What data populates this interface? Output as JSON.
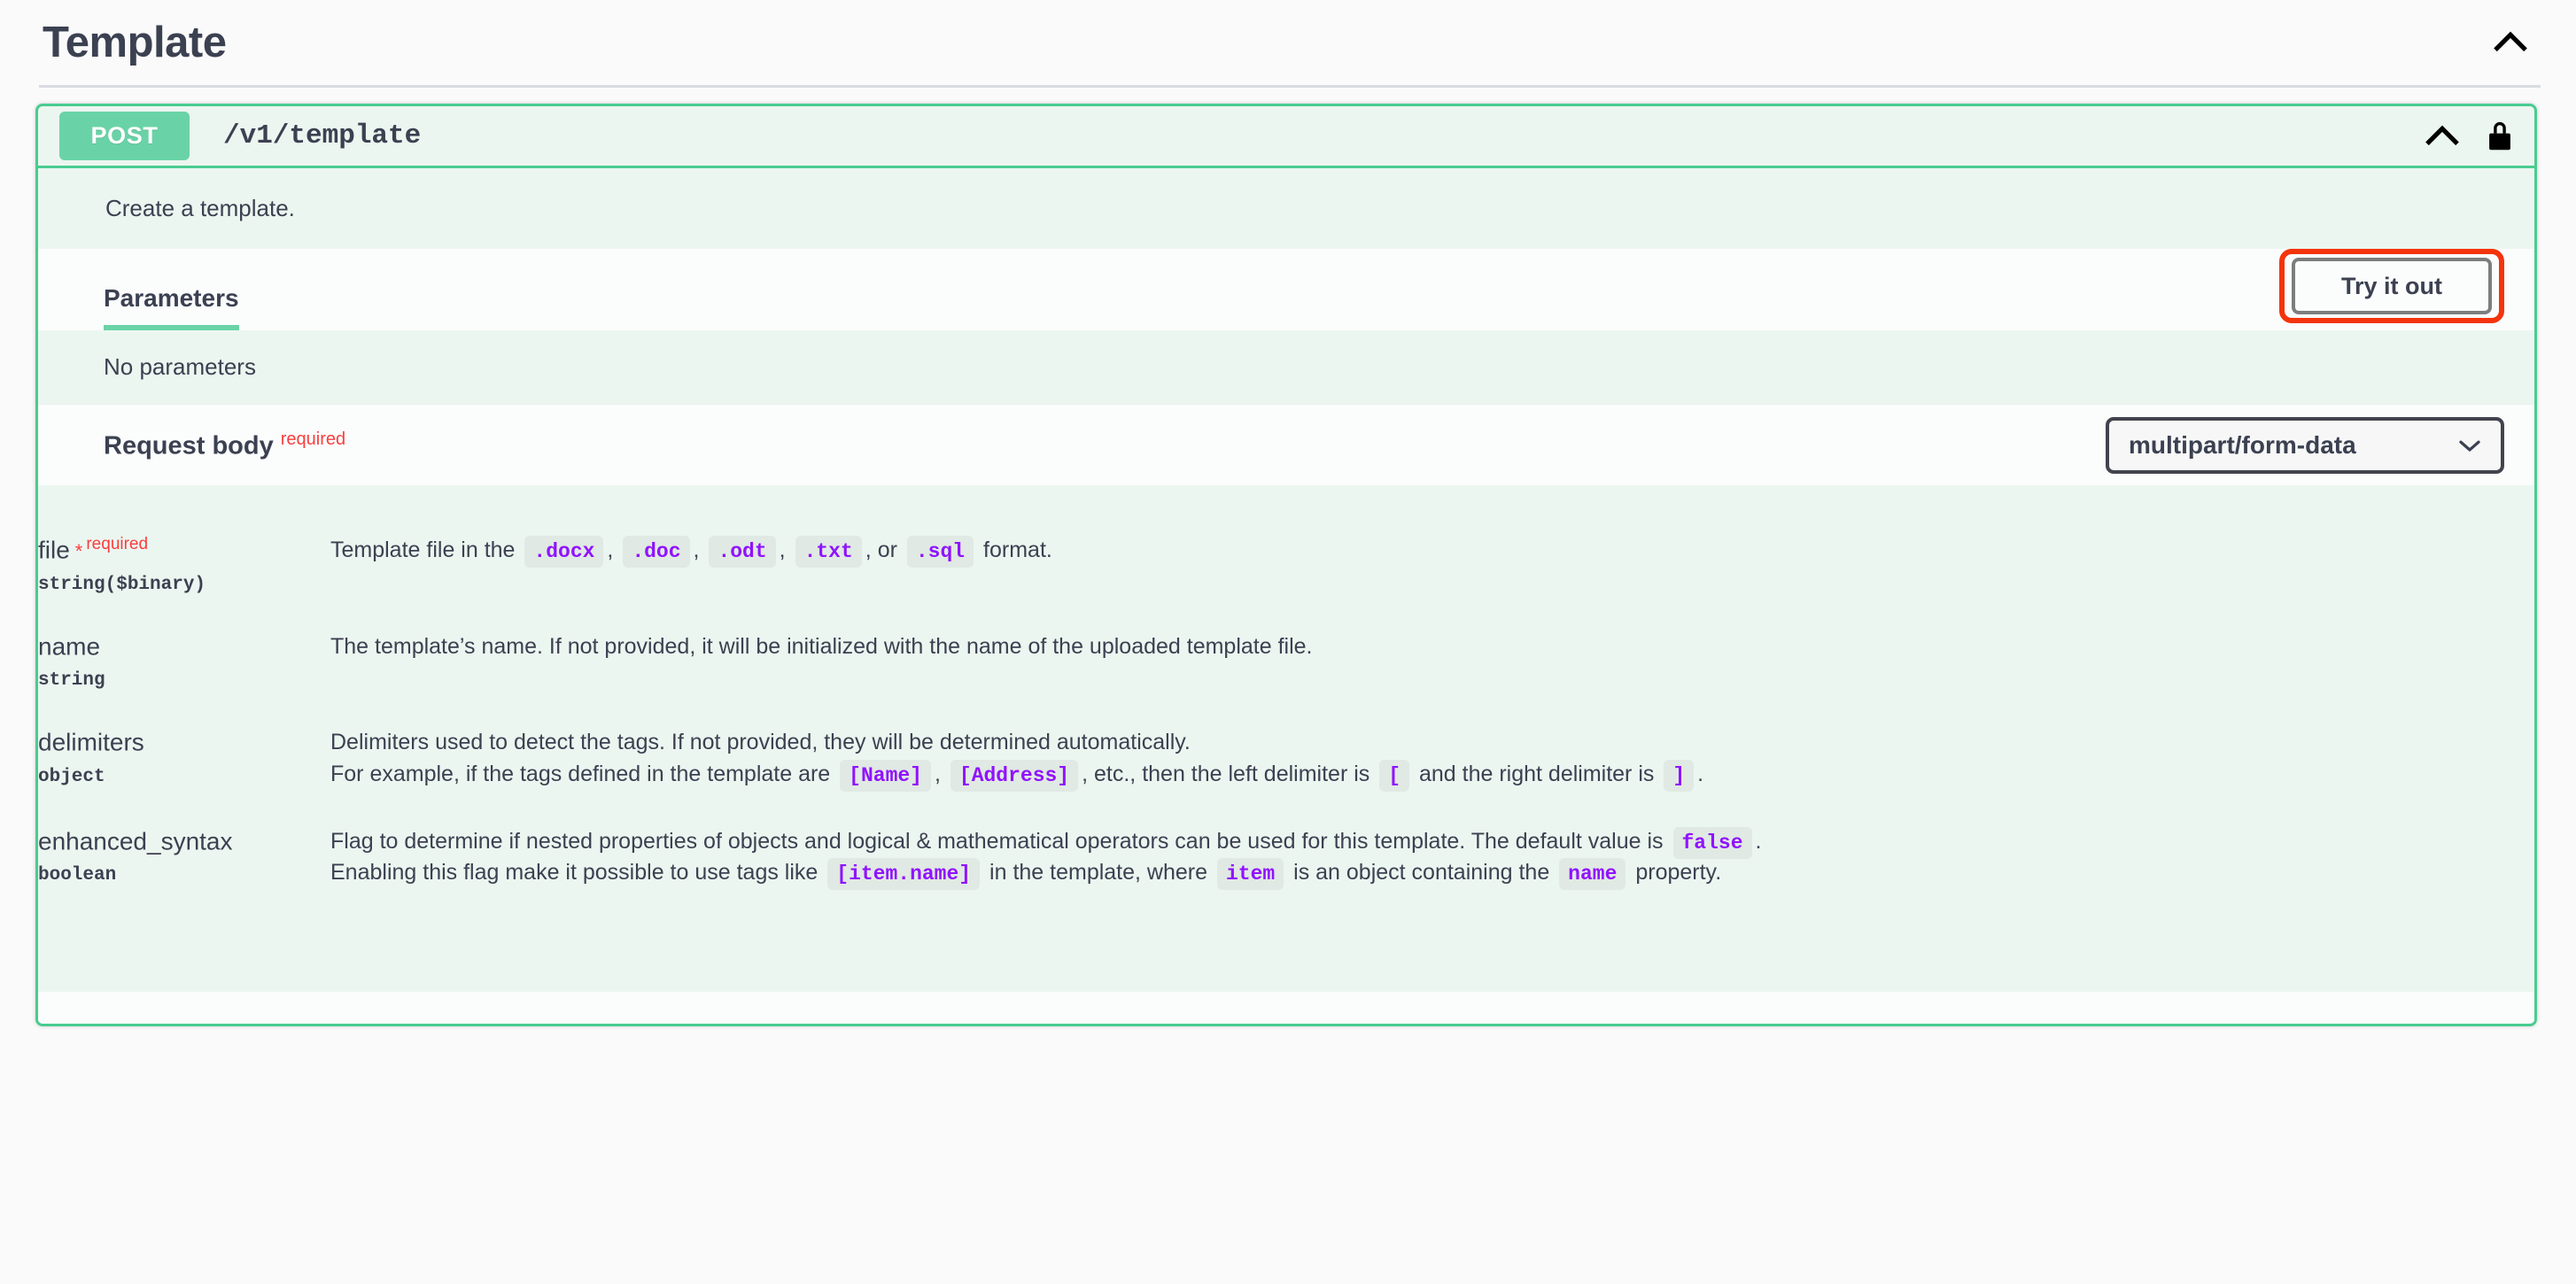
{
  "tag": {
    "title": "Template",
    "collapse_icon": "chevron-up-icon"
  },
  "operation": {
    "method": "POST",
    "path": "/v1/template",
    "description": "Create a template.",
    "auth_icon": "lock-icon",
    "collapse_icon": "chevron-up-icon"
  },
  "parameters_section": {
    "tab_label": "Parameters",
    "try_it_out_label": "Try it out",
    "no_parameters_text": "No parameters"
  },
  "request_body": {
    "label": "Request body",
    "required_flag": "required",
    "content_type_selected": "multipart/form-data",
    "content_type_options": [
      "multipart/form-data"
    ],
    "chevron_icon": "chevron-down-icon"
  },
  "params": [
    {
      "name": "file",
      "star": "*",
      "required_text": "required",
      "type": "string($binary)",
      "lines": [
        [
          {
            "t": "text",
            "v": "Template file in the "
          },
          {
            "t": "code",
            "v": ".docx"
          },
          {
            "t": "text",
            "v": ", "
          },
          {
            "t": "code",
            "v": ".doc"
          },
          {
            "t": "text",
            "v": ", "
          },
          {
            "t": "code",
            "v": ".odt"
          },
          {
            "t": "text",
            "v": ", "
          },
          {
            "t": "code",
            "v": ".txt"
          },
          {
            "t": "text",
            "v": ", or "
          },
          {
            "t": "code",
            "v": ".sql"
          },
          {
            "t": "text",
            "v": " format."
          }
        ]
      ]
    },
    {
      "name": "name",
      "star": "",
      "required_text": "",
      "type": "string",
      "lines": [
        [
          {
            "t": "text",
            "v": "The template’s name. If not provided, it will be initialized with the name of the uploaded template file."
          }
        ]
      ]
    },
    {
      "name": "delimiters",
      "star": "",
      "required_text": "",
      "type": "object",
      "lines": [
        [
          {
            "t": "text",
            "v": "Delimiters used to detect the tags. If not provided, they will be determined automatically."
          }
        ],
        [
          {
            "t": "text",
            "v": "For example, if the tags defined in the template are "
          },
          {
            "t": "code",
            "v": "[Name]"
          },
          {
            "t": "text",
            "v": ", "
          },
          {
            "t": "code",
            "v": "[Address]"
          },
          {
            "t": "text",
            "v": ", etc., then the left delimiter is "
          },
          {
            "t": "code",
            "v": "["
          },
          {
            "t": "text",
            "v": " and the right delimiter is "
          },
          {
            "t": "code",
            "v": "]"
          },
          {
            "t": "text",
            "v": "."
          }
        ]
      ]
    },
    {
      "name": "enhanced_syntax",
      "star": "",
      "required_text": "",
      "type": "boolean",
      "lines": [
        [
          {
            "t": "text",
            "v": "Flag to determine if nested properties of objects and logical & mathematical operators can be used for this template. The default value is "
          },
          {
            "t": "code",
            "v": "false"
          },
          {
            "t": "text",
            "v": "."
          }
        ],
        [
          {
            "t": "text",
            "v": "Enabling this flag make it possible to use tags like "
          },
          {
            "t": "code",
            "v": "[item.name]"
          },
          {
            "t": "text",
            "v": " in the template, where "
          },
          {
            "t": "code",
            "v": "item"
          },
          {
            "t": "text",
            "v": " is an object containing the "
          },
          {
            "t": "code",
            "v": "name"
          },
          {
            "t": "text",
            "v": " property."
          }
        ]
      ]
    }
  ],
  "colors": {
    "method_post": "#69d3a7",
    "opblock_border": "#49cc90",
    "opblock_bg": "#ecf6f0",
    "text": "#3b4151",
    "required_red": "#f93e3e",
    "code_purple": "#9012fe",
    "highlight_ring": "#f4340c"
  }
}
